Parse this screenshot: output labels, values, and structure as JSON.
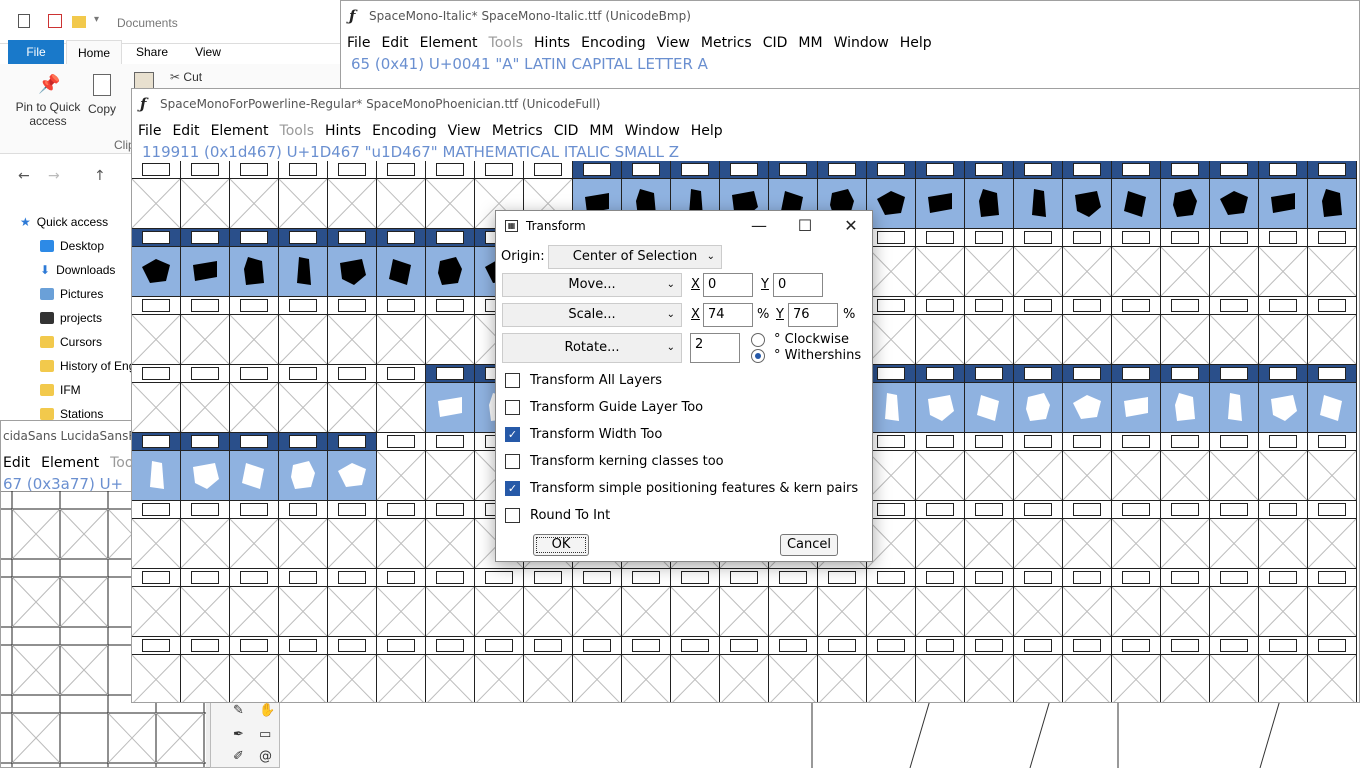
{
  "explorer": {
    "title": "Documents",
    "tabs": [
      "File",
      "Home",
      "Share",
      "View"
    ],
    "ribbon": {
      "pin_label": "Pin to Quick access",
      "copy_label": "Copy",
      "cut_label": "Cut",
      "clip_label": "Clip"
    },
    "nav": [
      "Quick access",
      "Desktop",
      "Downloads",
      "Pictures",
      "projects",
      "Cursors",
      "History of Eng",
      "IFM",
      "Stations"
    ]
  },
  "win_back": {
    "title": "SpaceMono-Italic*  SpaceMono-Italic.ttf (UnicodeBmp)",
    "menu": [
      "File",
      "Edit",
      "Element",
      "Tools",
      "Hints",
      "Encoding",
      "View",
      "Metrics",
      "CID",
      "MM",
      "Window",
      "Help"
    ],
    "info": "65 (0x41) U+0041 \"A\" LATIN CAPITAL LETTER A"
  },
  "win_left": {
    "title": "cidaSans  LucidaSansRe",
    "menu": [
      "Edit",
      "Element",
      "Tool"
    ],
    "info": "67 (0x3a77) U+"
  },
  "win_main": {
    "title": "SpaceMonoForPowerline-Regular*  SpaceMonoPhoenician.ttf (UnicodeFull)",
    "menu": [
      "File",
      "Edit",
      "Element",
      "Tools",
      "Hints",
      "Encoding",
      "View",
      "Metrics",
      "CID",
      "MM",
      "Window",
      "Help"
    ],
    "info": "119911 (0x1d467) U+1D467 \"u1D467\" MATHEMATICAL ITALIC SMALL Z"
  },
  "dialog": {
    "title": "Transform",
    "origin_label": "Origin:",
    "origin_value": "Center of Selection",
    "move": {
      "label": "Move...",
      "x": "0",
      "y": "0"
    },
    "scale": {
      "label": "Scale...",
      "x": "74",
      "y": "76",
      "unit": "%"
    },
    "rotate": {
      "label": "Rotate...",
      "value": "2",
      "clockwise": "° Clockwise",
      "withershins": "° Withershins",
      "selected": "withershins"
    },
    "x_label": "X",
    "y_label": "Y",
    "options": [
      {
        "label": "Transform All Layers",
        "checked": false
      },
      {
        "label": "Transform Guide Layer Too",
        "checked": false
      },
      {
        "label": "Transform Width Too",
        "checked": true
      },
      {
        "label": "Transform kerning classes too",
        "checked": false
      },
      {
        "label": "Transform simple positioning features & kern pairs",
        "checked": true
      },
      {
        "label": "Round To Int",
        "checked": false
      }
    ],
    "ok": "OK",
    "cancel": "Cancel"
  },
  "colors": {
    "accent": "#2659a8",
    "selection": "#8fb2e0",
    "info": "#6a8fd0"
  }
}
